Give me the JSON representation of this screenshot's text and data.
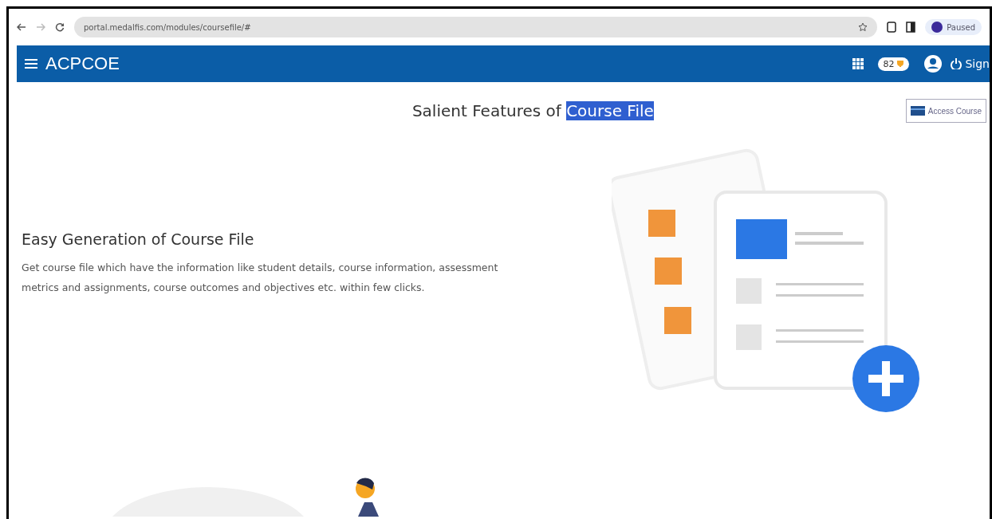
{
  "browser": {
    "url": "portal.medalfis.com/modules/coursefile/#",
    "profile": "Paused"
  },
  "navbar": {
    "brand": "ACPCOE",
    "points": "82",
    "signout": "Sign"
  },
  "page": {
    "title": "Salient Features of ",
    "title_selected": "Course File",
    "access_button": "Access Course"
  },
  "feature": {
    "heading": "Easy Generation of Course File",
    "description": "Get course file which have the information like student details, course information, assessment metrics and assignments, course outcomes and objectives etc. within few clicks."
  }
}
